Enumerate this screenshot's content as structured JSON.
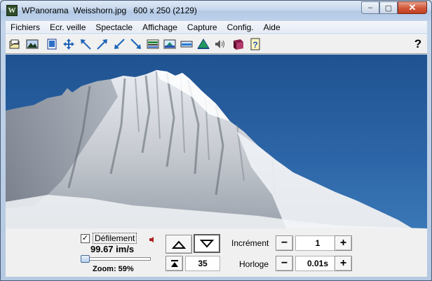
{
  "window": {
    "title": "WPanorama  Weisshorn.jpg   600 x 250 (2129)",
    "app_icon_glyph": "W",
    "minimize_glyph": "–",
    "maximize_glyph": "▢",
    "close_glyph": "✕"
  },
  "menu": {
    "items": [
      "Fichiers",
      "Ecr. veille",
      "Spectacle",
      "Affichage",
      "Capture",
      "Config.",
      "Aide"
    ]
  },
  "toolbar": {
    "buttons": [
      "open-file-icon",
      "picture-icon",
      "slide-icon",
      "move-all-icon",
      "arrow-nw-icon",
      "arrow-ne-icon",
      "arrow-sw-icon",
      "arrow-se-icon",
      "panorama-1-icon",
      "panorama-2-icon",
      "panorama-3-icon",
      "mountain-icon",
      "sound-icon",
      "book-icon",
      "help-page-icon"
    ],
    "help_label": "?"
  },
  "controls": {
    "scroll_checked": true,
    "scroll_label": "Défilement",
    "check_glyph": "✓",
    "rate": "99.67 im/s",
    "zoom": "Zoom: 59%",
    "zoom_slider_value": 0.0,
    "step_value": "35",
    "increment_label": "Incrément",
    "increment_value": "1",
    "clock_label": "Horloge",
    "clock_value": "0.01s",
    "minus_glyph": "−",
    "plus_glyph": "+"
  },
  "colors": {
    "sky": "#2a5e9e",
    "titlebar": "#c6d8ee",
    "close": "#c23d20"
  }
}
